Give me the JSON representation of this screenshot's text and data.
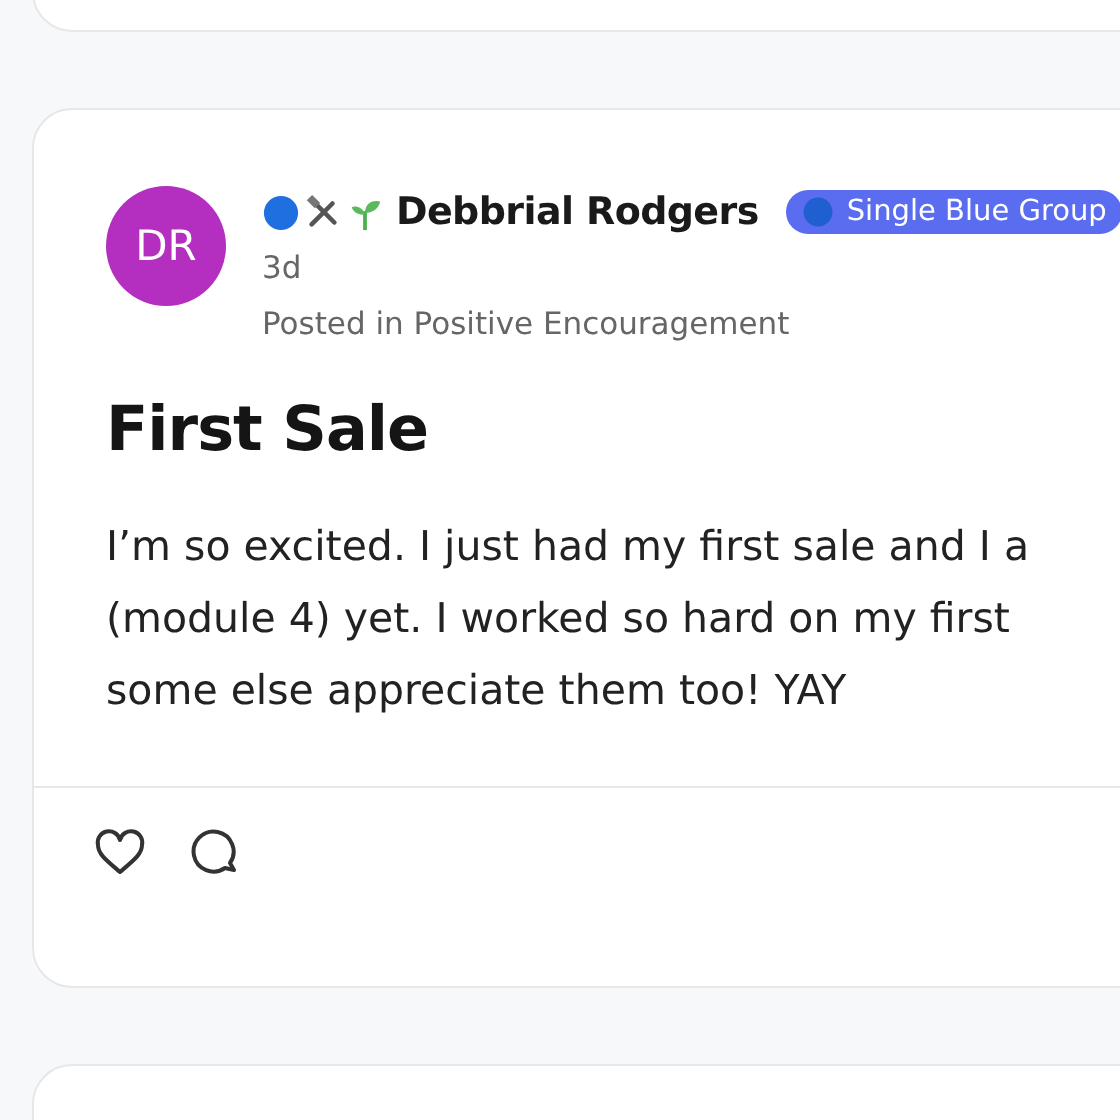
{
  "post": {
    "avatar_initials": "DR",
    "author": "Debbrial Rodgers",
    "group_badge": "Single Blue Group",
    "time": "3d",
    "posted_in": "Posted in Positive Encouragement",
    "title": "First Sale",
    "body_lines": [
      "I’m so excited. I just had my first sale and I a",
      "(module 4) yet. I worked so hard on my first",
      "some else appreciate them too! YAY"
    ]
  }
}
